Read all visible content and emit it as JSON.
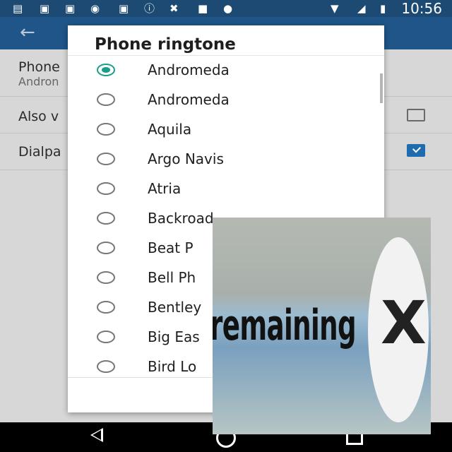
{
  "status_bar": {
    "time": "10:56",
    "icons": [
      "message-icon",
      "facebook-icon",
      "facebook-icon",
      "eye-icon",
      "facebook-icon",
      "info-icon",
      "no-location-icon",
      "lock-icon",
      "android-icon",
      "wifi-icon",
      "no-signal-icon",
      "battery-charging-icon"
    ]
  },
  "app_bar": {
    "back_icon": "back-arrow-icon"
  },
  "settings": {
    "phone_ringtone_title": "Phone",
    "phone_ringtone_value": "Andron",
    "also_vibrate_label": "Also v",
    "also_vibrate_checked": false,
    "dialpad_label": "Dialpa",
    "dialpad_checked": true
  },
  "dialog": {
    "title": "Phone ringtone",
    "options": [
      {
        "label": "Andromeda",
        "selected": true
      },
      {
        "label": "Andromeda",
        "selected": false
      },
      {
        "label": "Aquila",
        "selected": false
      },
      {
        "label": "Argo Navis",
        "selected": false
      },
      {
        "label": "Atria",
        "selected": false
      },
      {
        "label": "Backroad",
        "selected": false
      },
      {
        "label": "Beat P",
        "selected": false
      },
      {
        "label": "Bell Ph",
        "selected": false
      },
      {
        "label": "Bentley",
        "selected": false
      },
      {
        "label": "Big Eas",
        "selected": false
      },
      {
        "label": "Bird Lo",
        "selected": false
      }
    ]
  },
  "ad_overlay": {
    "text": "remaining",
    "close_symbol": "X"
  },
  "colors": {
    "accent": "#1a9e88",
    "status_bar": "#1d4a73",
    "app_bar": "#1f5588",
    "checkbox": "#1f6bb0"
  }
}
